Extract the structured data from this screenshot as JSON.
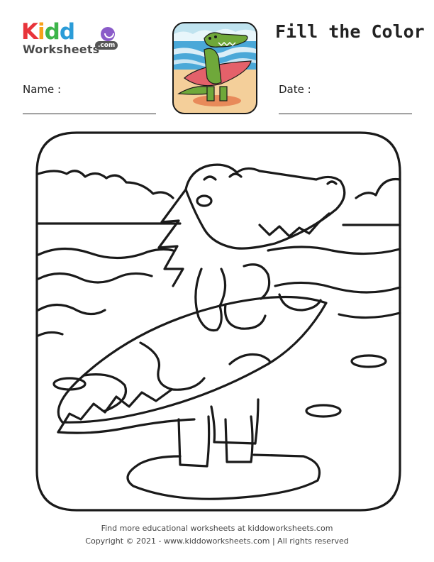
{
  "logo": {
    "kiddo_letters": [
      "K",
      "i",
      "d",
      "d",
      "o"
    ],
    "kiddo_colors": [
      "#e8343b",
      "#f7a21b",
      "#3db54a",
      "#2b9cd8",
      "#8a5bc9"
    ],
    "worksheets": "Worksheets",
    "com": ".com"
  },
  "title": "Fill the Color",
  "fields": {
    "name_label": "Name :",
    "date_label": "Date :"
  },
  "footer": {
    "line1": "Find more educational worksheets at kiddoworksheets.com",
    "line2": "Copyright © 2021 - www.kiddoworksheets.com  |  All rights reserved"
  },
  "colors": {
    "outline": "#1a1a1a",
    "croc_green": "#6fa83a",
    "surfboard_red": "#e4616a",
    "sea_blue": "#4aa8d8",
    "sand": "#f4cf9a",
    "sky": "#bfe3ef"
  }
}
